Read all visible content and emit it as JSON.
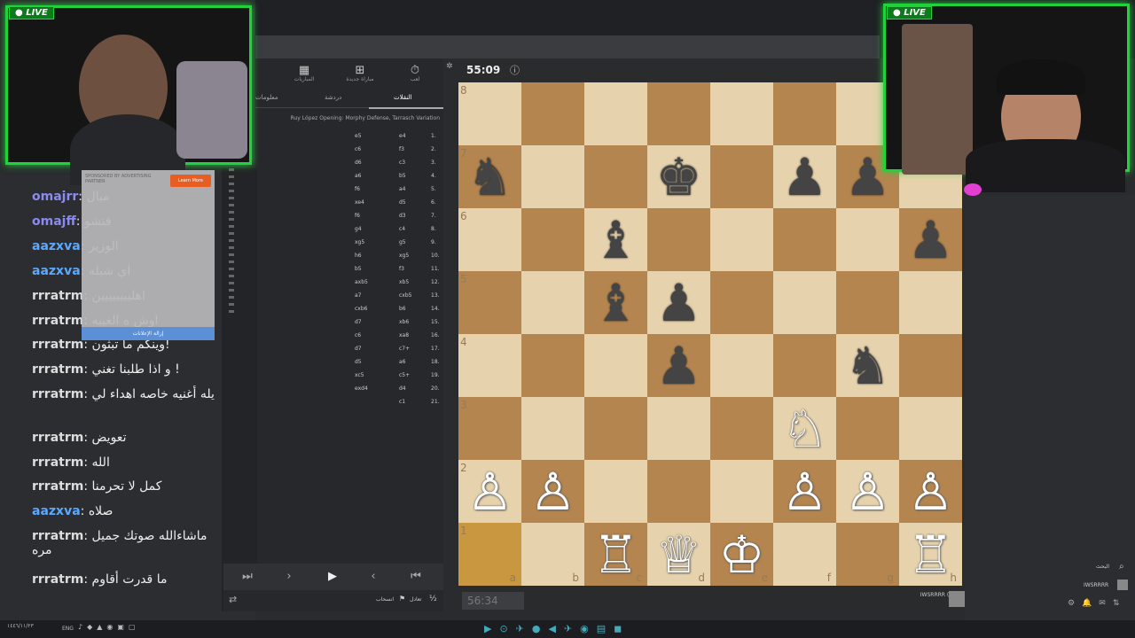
{
  "top": {
    "timer": "55:09"
  },
  "panel": {
    "icons": [
      {
        "icon": "timer-icon",
        "label": "لعب"
      },
      {
        "icon": "plus-icon",
        "label": "مباراة جديدة"
      },
      {
        "icon": "grid-icon",
        "label": "المباريات"
      }
    ],
    "tabs": [
      "النقلات",
      "دردشة",
      "معلومات"
    ],
    "opening": "Ruy López Opening: Morphy Defense, Tarrasch Variation",
    "moves": [
      {
        "n": "1.",
        "w": "e4",
        "b": "e5"
      },
      {
        "n": "2.",
        "w": "f3",
        "b": "c6"
      },
      {
        "n": "3.",
        "w": "c3",
        "b": "d6"
      },
      {
        "n": "4.",
        "w": "b5",
        "b": "a6"
      },
      {
        "n": "5.",
        "w": "a4",
        "b": "f6"
      },
      {
        "n": "6.",
        "w": "d5",
        "b": "xe4"
      },
      {
        "n": "7.",
        "w": "d3",
        "b": "f6"
      },
      {
        "n": "8.",
        "w": "c4",
        "b": "g4"
      },
      {
        "n": "9.",
        "w": "g5",
        "b": "xg5"
      },
      {
        "n": "10.",
        "w": "xg5",
        "b": "h6"
      },
      {
        "n": "11.",
        "w": "f3",
        "b": "b5"
      },
      {
        "n": "12.",
        "w": "xb5",
        "b": "axb5"
      },
      {
        "n": "13.",
        "w": "cxb5",
        "b": "a7"
      },
      {
        "n": "14.",
        "w": "b6",
        "b": "cxb6"
      },
      {
        "n": "15.",
        "w": "xb6",
        "b": "d7"
      },
      {
        "n": "16.",
        "w": "xa8",
        "b": "c6"
      },
      {
        "n": "17.",
        "w": "c7+",
        "b": "d7"
      },
      {
        "n": "18.",
        "w": "a6",
        "b": "d5"
      },
      {
        "n": "19.",
        "w": "c5+",
        "b": "xc5"
      },
      {
        "n": "20.",
        "w": "d4",
        "b": "exd4"
      },
      {
        "n": "21.",
        "w": "c1",
        "b": ""
      }
    ],
    "controls": {
      "first": "⏮",
      "prev": "‹",
      "play": "▶",
      "next": "›",
      "last": "⏭"
    },
    "draw": "تعادل",
    "resign": "انسحاب",
    "half": "½"
  },
  "board": {
    "ranks": [
      "8",
      "7",
      "6",
      "5",
      "4",
      "3",
      "2",
      "1"
    ],
    "files": [
      "a",
      "b",
      "c",
      "d",
      "e",
      "f",
      "g",
      "h"
    ],
    "rows": [
      [
        "",
        "",
        "",
        "",
        "",
        "",
        "",
        ""
      ],
      [
        "bn",
        "",
        "",
        "bk",
        "",
        "bp",
        "bp",
        ""
      ],
      [
        "",
        "",
        "bb",
        "",
        "",
        "",
        "",
        "bp"
      ],
      [
        "",
        "",
        "bb",
        "bp",
        "",
        "",
        "",
        ""
      ],
      [
        "",
        "",
        "",
        "bp",
        "",
        "",
        "bn",
        ""
      ],
      [
        "",
        "",
        "",
        "",
        "",
        "wn",
        "",
        ""
      ],
      [
        "wp",
        "wp",
        "",
        "",
        "",
        "wp",
        "wp",
        "wp"
      ],
      [
        "",
        "",
        "wr",
        "wq",
        "wk",
        "",
        "",
        "wr"
      ]
    ],
    "clock_bottom": "56:34",
    "player": "IWSRRRR (580)"
  },
  "streams": {
    "live": "LIVE"
  },
  "ad": {
    "sponsor": "SPONSORED BY ADVERTISING PARTNER",
    "button": "Learn More",
    "remove": "إزالة الإعلانات"
  },
  "chat": [
    {
      "user": "omajrr",
      "msg": "مبال",
      "cls": "u3"
    },
    {
      "user": "omajff",
      "msg": "فنشو",
      "cls": "u3"
    },
    {
      "user": "aazxva",
      "msg": "الوزير",
      "cls": "u1"
    },
    {
      "user": "aazxva",
      "msg": "اي شبله",
      "cls": "u1"
    },
    {
      "user": "rrratrm",
      "msg": "اهليييييييين",
      "cls": "u4"
    },
    {
      "user": "rrratrm",
      "msg": "اوش ه الغيبه",
      "cls": "u4"
    },
    {
      "user": "rrratrm",
      "msg": "وينكم ما تبثون!",
      "cls": "u4"
    },
    {
      "user": "rrratrm",
      "msg": "و اذا طلبنا تغني !",
      "cls": "u4"
    },
    {
      "user": "rrratrm",
      "msg": "يله أغنيه خاصه اهداء لي",
      "cls": "u4"
    },
    {
      "user": "rrratrm",
      "msg": "تعويض",
      "cls": "u4"
    },
    {
      "user": "rrratrm",
      "msg": "الله",
      "cls": "u4"
    },
    {
      "user": "rrratrm",
      "msg": "كمل لا تحرمنا",
      "cls": "u4"
    },
    {
      "user": "aazxva",
      "msg": "صلاه",
      "cls": "u1"
    },
    {
      "user": "rrratrm",
      "msg": "ماشاءالله صوتك جميل مره",
      "cls": "u4"
    },
    {
      "user": "rrratrm",
      "msg": "ما قدرت أقاوم",
      "cls": "u4"
    }
  ],
  "rightside": {
    "search": "البحث",
    "user": "IWSRRRR"
  },
  "taskbar": {
    "lang": "ENG",
    "date": "١٤٤٦/١١/٢٣"
  }
}
